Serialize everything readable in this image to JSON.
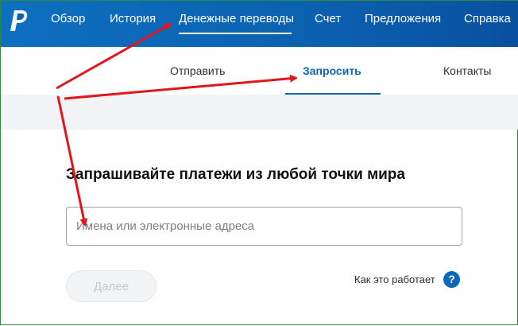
{
  "nav": {
    "items": [
      {
        "label": "Обзор"
      },
      {
        "label": "История"
      },
      {
        "label": "Денежные переводы"
      },
      {
        "label": "Счет"
      },
      {
        "label": "Предложения"
      },
      {
        "label": "Справка"
      }
    ],
    "active_index": 2,
    "logo_icon": "paypal-logo"
  },
  "subnav": {
    "items": [
      {
        "label": "Отправить"
      },
      {
        "label": "Запросить"
      },
      {
        "label": "Контакты"
      }
    ],
    "active_index": 1
  },
  "main": {
    "headline": "Запрашивайте платежи из любой точки мира",
    "recipient_placeholder": "Имена или электронные адреса",
    "recipient_value": "",
    "next_label": "Далее",
    "how_it_works_label": "Как это работает",
    "help_icon_glyph": "?"
  },
  "colors": {
    "nav_bg": "#0b61b0",
    "accent": "#0b68b8",
    "annotation_arrow": "#e3161b"
  }
}
